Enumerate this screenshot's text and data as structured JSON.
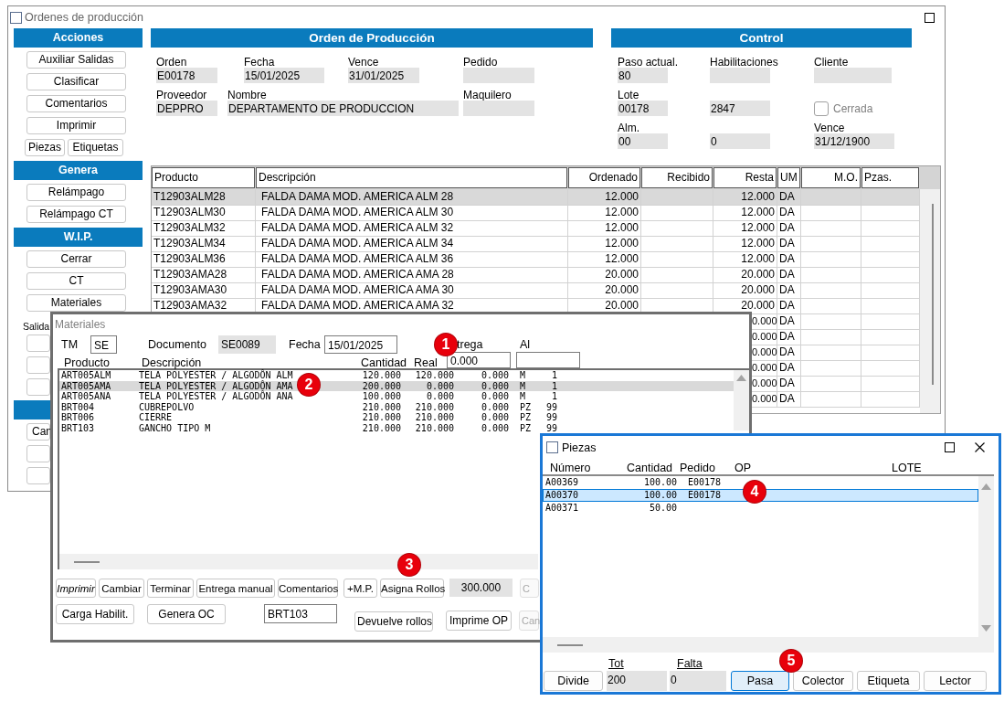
{
  "main_window": {
    "title": "Ordenes de producción",
    "sidebar": [
      {
        "kind": "header",
        "label": "Acciones"
      },
      {
        "kind": "button",
        "label": "Auxiliar Salidas"
      },
      {
        "kind": "button",
        "label": "Clasificar"
      },
      {
        "kind": "button",
        "label": "Comentarios"
      },
      {
        "kind": "button",
        "label": "Imprimir"
      },
      {
        "kind": "button_pair",
        "buttons": [
          "Piezas",
          "Etiquetas"
        ]
      },
      {
        "kind": "header",
        "label": "Genera"
      },
      {
        "kind": "button",
        "label": "Relámpago"
      },
      {
        "kind": "button",
        "label": "Relámpago CT"
      },
      {
        "kind": "header",
        "label": "W.I.P."
      },
      {
        "kind": "button",
        "label": "Cerrar"
      },
      {
        "kind": "button",
        "label": "CT"
      },
      {
        "kind": "button",
        "label": "Materiales"
      },
      {
        "kind": "label",
        "label": "Salida"
      },
      {
        "kind": "button"
      },
      {
        "kind": "button"
      },
      {
        "kind": "button"
      },
      {
        "kind": "header"
      },
      {
        "kind": "partial_button",
        "label": "Can"
      },
      {
        "kind": "button"
      },
      {
        "kind": "button"
      }
    ],
    "order_panel": {
      "title": "Orden de Producción",
      "fields": [
        {
          "label": "Orden",
          "value": "E00178"
        },
        {
          "label": "Fecha",
          "value": "15/01/2025"
        },
        {
          "label": "Vence",
          "value": "31/01/2025"
        },
        {
          "label": "Pedido"
        },
        {
          "label": "Proveedor",
          "value": "DEPPRO"
        },
        {
          "label": "Nombre",
          "value": "DEPARTAMENTO  DE PRODUCCION"
        },
        {
          "label": "Maquilero"
        }
      ]
    },
    "control_panel": {
      "title": "Control",
      "fields": [
        {
          "kind": "field",
          "label": "Paso actual.",
          "value": "80"
        },
        {
          "kind": "field",
          "label": "Habilitaciones"
        },
        {
          "kind": "field",
          "label": "Cliente"
        },
        {
          "kind": "field",
          "label": "Lote",
          "value": "00178"
        },
        {
          "kind": "field",
          "value": "2847"
        },
        {
          "kind": "checkbox",
          "label": "Cerrada",
          "checked": false,
          "disabled": true
        },
        {
          "kind": "field",
          "label": "Alm.",
          "value": "00"
        },
        {
          "kind": "field",
          "value": "0"
        },
        {
          "kind": "field",
          "label": "Vence",
          "value": "31/12/1900"
        }
      ]
    },
    "table": {
      "columns": [
        "Producto",
        "Descripción",
        "Ordenado",
        "Recibido",
        "Resta",
        "UM",
        "M.O.",
        "Pzas."
      ],
      "rows": [
        {
          "producto": "T12903ALM28",
          "descripcion": "FALDA DAMA MOD. AMERICA ALM 28",
          "ordenado": "12.000",
          "resta": "12.000",
          "um": "DA",
          "selected": true
        },
        {
          "producto": "T12903ALM30",
          "descripcion": "FALDA DAMA MOD. AMERICA ALM 30",
          "ordenado": "12.000",
          "resta": "12.000",
          "um": "DA",
          "selected": false
        },
        {
          "producto": "T12903ALM32",
          "descripcion": "FALDA DAMA MOD. AMERICA ALM 32",
          "ordenado": "12.000",
          "resta": "12.000",
          "um": "DA",
          "selected": false
        },
        {
          "producto": "T12903ALM34",
          "descripcion": "FALDA DAMA MOD. AMERICA ALM 34",
          "ordenado": "12.000",
          "resta": "12.000",
          "um": "DA",
          "selected": false
        },
        {
          "producto": "T12903ALM36",
          "descripcion": "FALDA DAMA MOD. AMERICA ALM 36",
          "ordenado": "12.000",
          "resta": "12.000",
          "um": "DA",
          "selected": false
        },
        {
          "producto": "T12903AMA28",
          "descripcion": "FALDA DAMA MOD. AMERICA AMA 28",
          "ordenado": "20.000",
          "resta": "20.000",
          "um": "DA",
          "selected": false
        },
        {
          "producto": "T12903AMA30",
          "descripcion": "FALDA DAMA MOD. AMERICA AMA 30",
          "ordenado": "20.000",
          "resta": "20.000",
          "um": "DA",
          "selected": false
        },
        {
          "producto": "T12903AMA32",
          "descripcion": "FALDA DAMA MOD. AMERICA AMA 32",
          "ordenado": "20.000",
          "resta": "20.000",
          "um": "DA",
          "selected": false
        },
        {
          "resta": "0.000",
          "um": "DA",
          "selected": false
        },
        {
          "resta": "0.000",
          "um": "DA",
          "selected": false
        },
        {
          "resta": "0.000",
          "um": "DA",
          "selected": false
        },
        {
          "resta": "0.000",
          "um": "DA",
          "selected": false
        },
        {
          "resta": "0.000",
          "um": "DA",
          "selected": false
        },
        {
          "resta": "0.000",
          "um": "DA",
          "selected": false
        }
      ]
    }
  },
  "materiales_window": {
    "title": "Materiales",
    "fields": [
      {
        "kind": "input",
        "label": "TM",
        "value": "SE"
      },
      {
        "kind": "readout",
        "label": "Documento",
        "value": "SE0089"
      },
      {
        "kind": "input",
        "label": "Fecha",
        "value": "15/01/2025"
      }
    ],
    "range_fields": [
      {
        "label": "trega",
        "value": "0.000"
      },
      {
        "label": "Al"
      }
    ],
    "columns": [
      "Producto",
      "Descripción",
      "Cantidad",
      "Real"
    ],
    "rows": [
      {
        "producto": "ART005ALM",
        "descripcion": "TELA POLYESTER / ALGODÔN ALM",
        "cantidad": "120.000",
        "real": "120.000",
        "column_5": "0.000",
        "column_6": "M",
        "column_7": "1",
        "selected": false
      },
      {
        "producto": "ART005AMA",
        "descripcion": "TELA POLYESTER / ALGODÔN AMA",
        "cantidad": "200.000",
        "real": "0.000",
        "column_5": "0.000",
        "column_6": "M",
        "column_7": "1",
        "selected": true
      },
      {
        "producto": "ART005ANA",
        "descripcion": "TELA POLYESTER / ALGODÔN ANA",
        "cantidad": "100.000",
        "real": "0.000",
        "column_5": "0.000",
        "column_6": "M",
        "column_7": "1",
        "selected": false
      },
      {
        "producto": "BRT004",
        "descripcion": "CUBREPOLVO",
        "cantidad": "210.000",
        "real": "210.000",
        "column_5": "0.000",
        "column_6": "PZ",
        "column_7": "99",
        "selected": false
      },
      {
        "producto": "BRT006",
        "descripcion": "CIERRE",
        "cantidad": "210.000",
        "real": "210.000",
        "column_5": "0.000",
        "column_6": "PZ",
        "column_7": "99",
        "selected": false
      },
      {
        "producto": "BRT103",
        "descripcion": "GANCHO TIPO M",
        "cantidad": "210.000",
        "real": "210.000",
        "column_5": "0.000",
        "column_6": "PZ",
        "column_7": "99",
        "selected": false
      }
    ],
    "buttons_row_1": [
      {
        "kind": "button",
        "label": "Imprimir",
        "italic": true,
        "disabled": false
      },
      {
        "kind": "button",
        "label": "Cambiar",
        "italic": false,
        "disabled": false
      },
      {
        "kind": "button",
        "label": "Terminar",
        "italic": false,
        "disabled": false
      },
      {
        "kind": "button",
        "label": "Entrega manual",
        "italic": false,
        "disabled": false
      },
      {
        "kind": "button",
        "label": "Comentarios",
        "italic": false,
        "disabled": false
      },
      {
        "kind": "button",
        "label": "+M.P.",
        "italic": false,
        "disabled": false
      },
      {
        "kind": "button",
        "label": "Asigna Rollos",
        "italic": false,
        "disabled": false
      },
      {
        "kind": "readout",
        "value": "300.000"
      },
      {
        "kind": "button",
        "label": "C",
        "italic": false,
        "disabled": true
      }
    ],
    "buttons_row_2": [
      {
        "kind": "button",
        "label": "Carga Habilit.",
        "italic": false,
        "disabled": false
      },
      {
        "kind": "button",
        "label": "Genera OC",
        "italic": false,
        "disabled": false
      },
      {
        "kind": "input",
        "value": "BRT103"
      },
      {
        "kind": "button",
        "label": "Devuelve rollos",
        "italic": false,
        "disabled": false
      },
      {
        "kind": "button",
        "label": "Imprime OP",
        "italic": false,
        "disabled": false
      },
      {
        "kind": "button",
        "label": "Can",
        "italic": false,
        "disabled": true
      }
    ],
    "markers": [
      "1",
      "2",
      "3"
    ]
  },
  "piezas_window": {
    "title": "Piezas",
    "columns": [
      "Número",
      "Cantidad",
      "Pedido",
      "OP",
      "LOTE"
    ],
    "rows": [
      {
        "numero": "A00369",
        "cantidad": "100.00",
        "pedido": "E00178",
        "selected": false
      },
      {
        "numero": "A00370",
        "cantidad": "100.00",
        "pedido": "E00178",
        "selected": true
      },
      {
        "numero": "A00371",
        "cantidad": "50.00",
        "selected": false
      }
    ],
    "footer": [
      {
        "kind": "button",
        "label": "Divide",
        "focused": false
      },
      {
        "kind": "readout",
        "label": "Tot",
        "value": "200"
      },
      {
        "kind": "readout",
        "label": "Falta",
        "value": "0"
      },
      {
        "kind": "button",
        "label": "Pasa",
        "focused": true
      },
      {
        "kind": "button",
        "label": "Colector",
        "focused": false
      },
      {
        "kind": "button",
        "label": "Etiqueta",
        "focused": false
      },
      {
        "kind": "button",
        "label": "Lector",
        "focused": false
      }
    ],
    "markers": [
      "4",
      "5"
    ]
  }
}
